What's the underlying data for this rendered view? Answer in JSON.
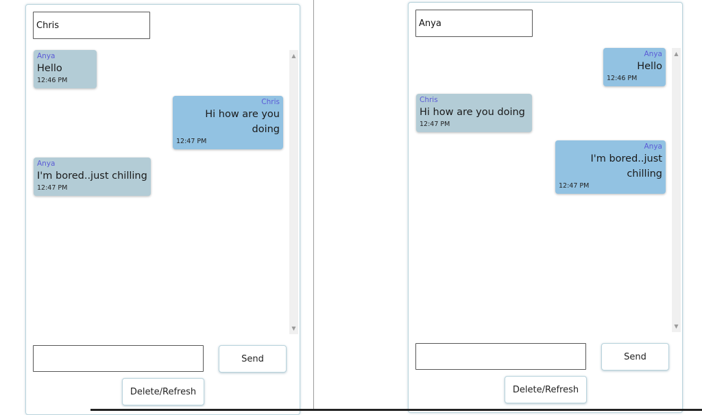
{
  "left_chat": {
    "name_value": "Chris",
    "messages": [
      {
        "sender": "Anya",
        "text": "Hello",
        "time": "12:46 PM",
        "side": "received"
      },
      {
        "sender": "Chris",
        "text": "Hi how are you doing",
        "time": "12:47 PM",
        "side": "sent"
      },
      {
        "sender": "Anya",
        "text": "I'm bored..just chilling",
        "time": "12:47 PM",
        "side": "received"
      }
    ],
    "message_value": "",
    "send_label": "Send",
    "refresh_label": "Delete/Refresh"
  },
  "right_chat": {
    "name_value": "Anya",
    "messages": [
      {
        "sender": "Anya",
        "text": "Hello",
        "time": "12:46 PM",
        "side": "sent"
      },
      {
        "sender": "Chris",
        "text": "Hi how are you doing",
        "time": "12:47 PM",
        "side": "received"
      },
      {
        "sender": "Anya",
        "text": "I'm bored..just chilling",
        "time": "12:47 PM",
        "side": "sent"
      }
    ],
    "message_value": "",
    "send_label": "Send",
    "refresh_label": "Delete/Refresh"
  },
  "scrollbar": {
    "up_arrow": "▲",
    "down_arrow": "▼"
  },
  "colors": {
    "received_bubble": "#b3ccd6",
    "sent_bubble": "#92c2e2",
    "sender_name": "#5b5bd6",
    "card_border": "#b8d3dc"
  }
}
